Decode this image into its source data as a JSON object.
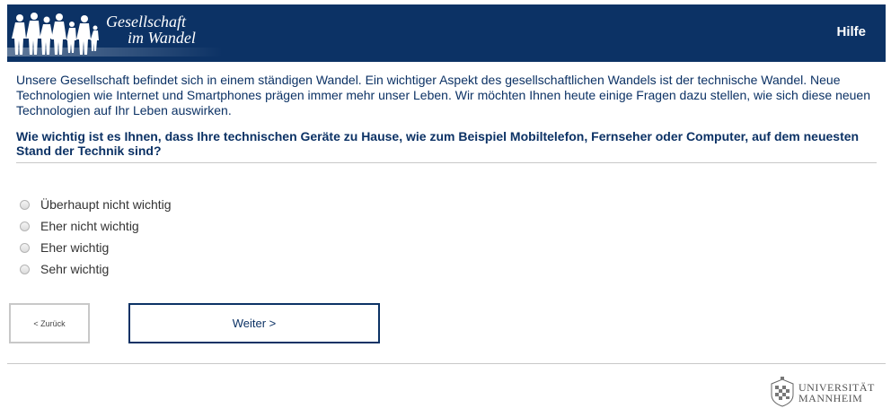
{
  "header": {
    "logo_line1": "Gesellschaft",
    "logo_line2": "im Wandel",
    "help_label": "Hilfe",
    "background_color": "#0c3265"
  },
  "intro_text": "Unsere Gesellschaft befindet sich in einem ständigen Wandel. Ein wichtiger Aspekt des gesellschaftlichen Wandels ist der technische Wandel. Neue Technologien wie Internet und Smartphones prägen immer mehr unser Leben. Wir möchten Ihnen heute einige Fragen dazu stellen, wie sich diese neuen Technologien auf Ihr Leben auswirken.",
  "question_text": "Wie wichtig ist es Ihnen, dass Ihre technischen Geräte zu Hause, wie zum Beispiel Mobiltelefon, Fernseher oder Computer, auf dem neuesten Stand der Technik sind?",
  "options": [
    {
      "label": "Überhaupt nicht wichtig",
      "selected": false
    },
    {
      "label": "Eher nicht wichtig",
      "selected": false
    },
    {
      "label": "Eher wichtig",
      "selected": false
    },
    {
      "label": "Sehr wichtig",
      "selected": false
    }
  ],
  "nav": {
    "back_label": "< Zurück",
    "next_label": "Weiter >"
  },
  "footer": {
    "university_line1": "UNIVERSITÄT",
    "university_line2": "MANNHEIM",
    "seal_icon": "university-seal-icon"
  }
}
